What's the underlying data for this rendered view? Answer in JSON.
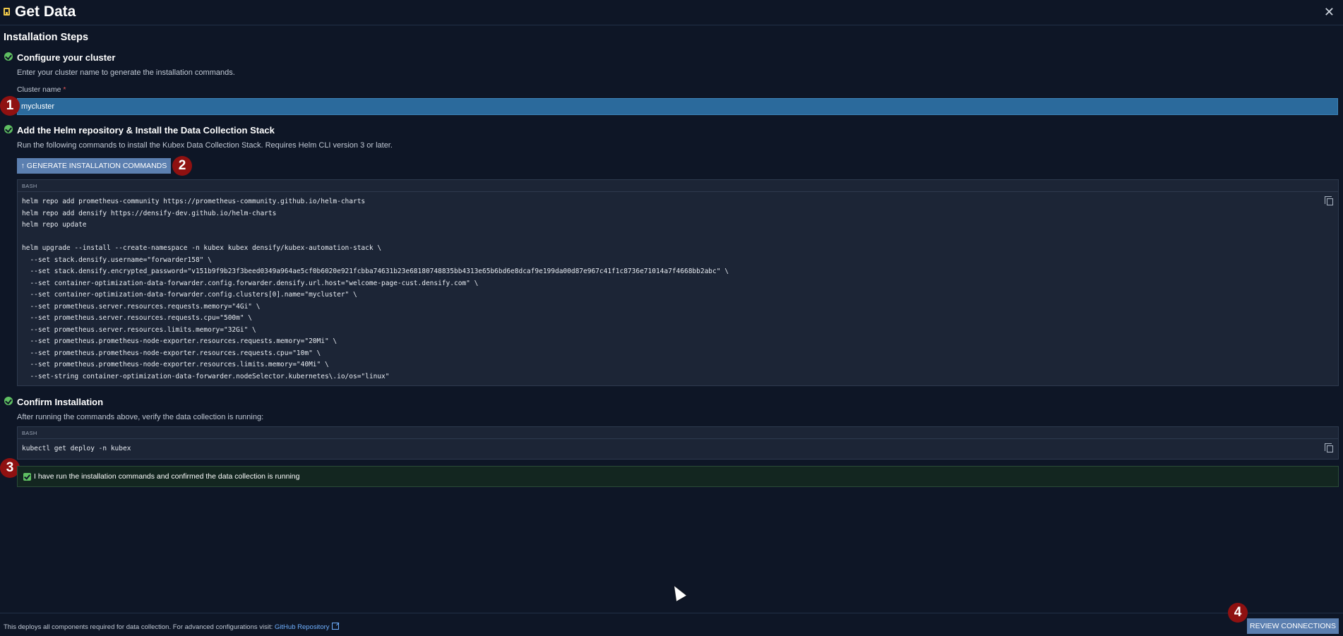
{
  "header": {
    "title": "Get Data",
    "close_label": "✕"
  },
  "section": {
    "title": "Installation Steps"
  },
  "steps": {
    "configure": {
      "title": "Configure your cluster",
      "desc": "Enter your cluster name to generate the installation commands.",
      "field_label": "Cluster name",
      "required_mark": "*",
      "cluster_value": "mycluster"
    },
    "helm": {
      "title": "Add the Helm repository & Install the Data Collection Stack",
      "desc": "Run the following commands to install the Kubex Data Collection Stack. Requires Helm CLI version 3 or later.",
      "button_label": "↑ GENERATE INSTALLATION COMMANDS",
      "code_lang": "BASH",
      "code_lines": [
        "helm repo add prometheus-community https://prometheus-community.github.io/helm-charts",
        "helm repo add densify https://densify-dev.github.io/helm-charts",
        "helm repo update",
        "",
        "helm upgrade --install --create-namespace -n kubex kubex densify/kubex-automation-stack \\",
        "  --set stack.densify.username=\"forwarder158\" \\",
        "  --set stack.densify.encrypted_password=\"v151b9f9b23f3beed0349a964ae5cf0b6020e921fcbba74631b23e68180748835bb4313e65b6bd6e8dcaf9e199da00d87e967c41f1c8736e71014a7f4668bb2abc\" \\",
        "  --set container-optimization-data-forwarder.config.forwarder.densify.url.host=\"welcome-page-cust.densify.com\" \\",
        "  --set container-optimization-data-forwarder.config.clusters[0].name=\"mycluster\" \\",
        "  --set prometheus.server.resources.requests.memory=\"4Gi\" \\",
        "  --set prometheus.server.resources.requests.cpu=\"500m\" \\",
        "  --set prometheus.server.resources.limits.memory=\"32Gi\" \\",
        "  --set prometheus.prometheus-node-exporter.resources.requests.memory=\"20Mi\" \\",
        "  --set prometheus.prometheus-node-exporter.resources.requests.cpu=\"10m\" \\",
        "  --set prometheus.prometheus-node-exporter.resources.limits.memory=\"40Mi\" \\",
        "  --set-string container-optimization-data-forwarder.nodeSelector.kubernetes\\.io/os=\"linux\""
      ]
    },
    "confirm": {
      "title": "Confirm Installation",
      "desc": "After running the commands above, verify the data collection is running:",
      "code_lang": "BASH",
      "code_lines": [
        "kubectl get deploy -n kubex"
      ],
      "checkbox_label": "I have run the installation commands and confirmed the data collection is running",
      "checked": true
    }
  },
  "badges": [
    "1",
    "2",
    "3",
    "4"
  ],
  "footer": {
    "note": "This deploys all components required for data collection. For advanced configurations visit:",
    "link_label": "GitHub Repository",
    "review_button": "REVIEW CONNECTIONS"
  },
  "colors": {
    "background": "#0e1626",
    "accent_button": "#5b7fb0",
    "input_highlight": "#2b6a9c",
    "success": "#5fbf62",
    "badge": "#8f1111",
    "link": "#6fb0ff"
  },
  "icons": {
    "logo": "bookmark-icon",
    "close": "close-icon",
    "step_status": "check-circle-icon",
    "copy": "copy-icon",
    "external": "external-link-icon"
  }
}
